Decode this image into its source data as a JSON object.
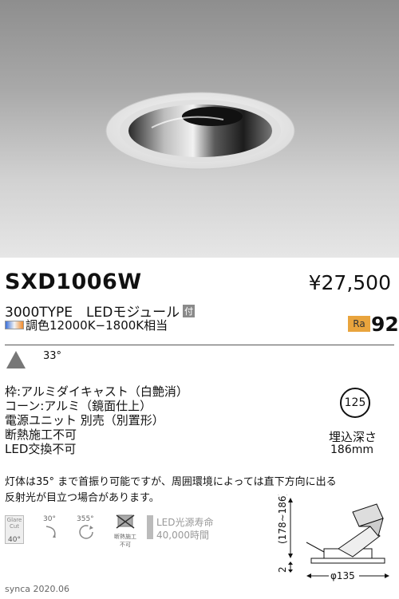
{
  "product": {
    "model": "SXD1006W",
    "price": "¥27,500",
    "type_line": "3000TYPE　LEDモジュール",
    "type_badge": "付",
    "color_text": "調色12000K−1800K相当",
    "ra_label": "Ra",
    "ra_value": "92"
  },
  "beam": {
    "angle": "33°"
  },
  "specs": [
    "枠:アルミダイキャスト（白艶消）",
    "コーン:アルミ（鏡面仕上）",
    "電源ユニット 別売（別置形）",
    "断熱施工不可",
    "LED交換不可"
  ],
  "cutout": {
    "diameter": "125",
    "depth_label": "埋込深さ",
    "depth_value": "186mm"
  },
  "notes": [
    "灯体は35° まで首振り可能ですが、周囲環境によっては直下方向に出る",
    "反射光が目立つ場合があります。"
  ],
  "icons": {
    "glare_cut_label": "Glare Cut",
    "glare_cut_value": "40°",
    "tilt_value": "30°",
    "rotate_value": "355°",
    "insulation_label": "断熱施工不可",
    "life_line1": "LED光源寿命",
    "life_line2": "40,000時間"
  },
  "dimensions": {
    "height_range": "(178∼186)",
    "offset": "2",
    "diameter": "φ135"
  },
  "footer": "synca 2020.06",
  "colors": {
    "ra_badge": "#e9a43d",
    "text": "#111111",
    "icon_gray": "#999999"
  }
}
